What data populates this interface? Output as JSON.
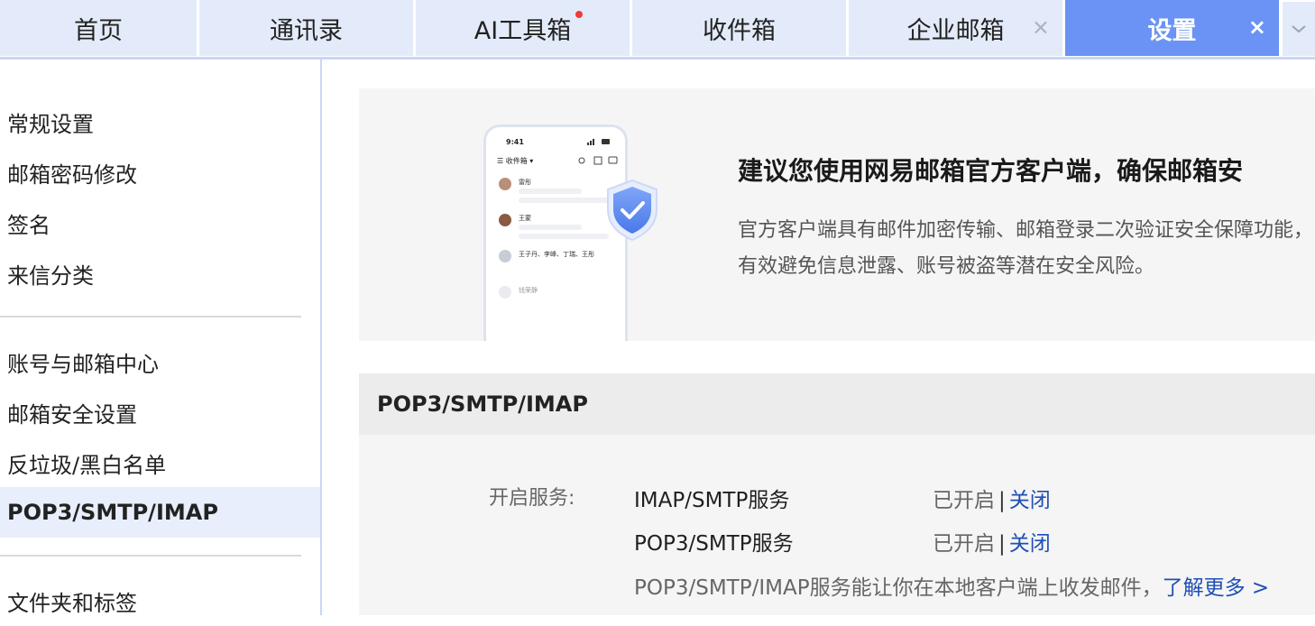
{
  "tabs": [
    {
      "label": "首页",
      "closable": false,
      "active": false
    },
    {
      "label": "通讯录",
      "closable": false,
      "active": false
    },
    {
      "label": "AI工具箱",
      "closable": false,
      "active": false,
      "has_dot": true
    },
    {
      "label": "收件箱",
      "closable": false,
      "active": false
    },
    {
      "label": "企业邮箱",
      "closable": true,
      "active": false
    },
    {
      "label": "设置",
      "closable": true,
      "active": true
    }
  ],
  "tab_close_glyph": "×",
  "sidebar": {
    "items": [
      {
        "label": "常规设置"
      },
      {
        "label": "邮箱密码修改"
      },
      {
        "label": "签名"
      },
      {
        "label": "来信分类"
      },
      {
        "label": "账号与邮箱中心"
      },
      {
        "label": "邮箱安全设置"
      },
      {
        "label": "反垃圾/黑白名单"
      },
      {
        "label": "POP3/SMTP/IMAP",
        "active": true
      },
      {
        "label": "文件夹和标签"
      }
    ]
  },
  "banner": {
    "title": "建议您使用网易邮箱官方客户端，确保邮箱安",
    "desc": "官方客户端具有邮件加密传输、邮箱登录二次验证安全保障功能，有效避免信息泄露、账号被盗等潜在安全风险。",
    "phone": {
      "time": "9:41",
      "inbox_label": "收件箱",
      "rows": [
        {
          "name": "雷彤"
        },
        {
          "name": "王蒙"
        },
        {
          "name": "王子丹、李峰、丁瑞、王彤"
        },
        {
          "name": "钱荣静"
        }
      ]
    }
  },
  "pop": {
    "header": "POP3/SMTP/IMAP",
    "service_label": "开启服务:",
    "services": [
      {
        "name": "IMAP/SMTP服务",
        "status": "已开启",
        "separator": "|",
        "action": "关闭"
      },
      {
        "name": "POP3/SMTP服务",
        "status": "已开启",
        "separator": "|",
        "action": "关闭"
      }
    ],
    "note": "POP3/SMTP/IMAP服务能让你在本地客户端上收发邮件，",
    "learn_more": "了解更多 >"
  },
  "colors": {
    "tab_bg": "#e3ebfa",
    "tab_active": "#6a93f5",
    "link": "#1f4fb5",
    "dot": "#ef3b3b"
  }
}
